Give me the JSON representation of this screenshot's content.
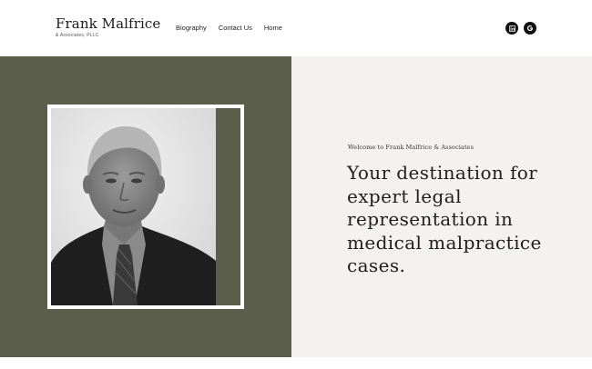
{
  "brand": {
    "name": "Frank Malfrice",
    "subtitle": "& Associates, PLLC"
  },
  "nav": {
    "items": [
      {
        "label": "Biography"
      },
      {
        "label": "Contact Us"
      },
      {
        "label": "Home"
      }
    ]
  },
  "social": {
    "icons": [
      "linkedin-icon",
      "google-icon"
    ]
  },
  "hero": {
    "eyebrow": "Welcome to Frank Malfrice & Associates",
    "headline": "Your destination for expert legal representation in medical malpractice cases."
  },
  "colors": {
    "olive": "#5b5e4a",
    "cream": "#f4f2ee",
    "icon_bg": "#111111"
  }
}
